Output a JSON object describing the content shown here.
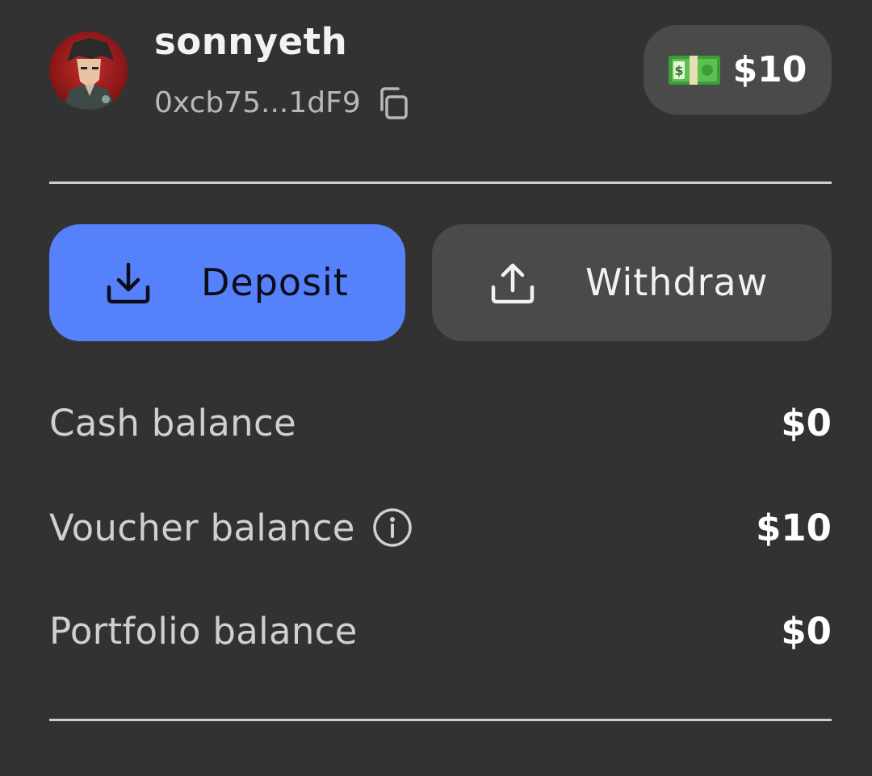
{
  "profile": {
    "username": "sonnyeth",
    "address": "0xcb75...1dF9",
    "avatar_icon": "anime-character-avatar",
    "copy_icon": "copy-icon"
  },
  "balance_pill": {
    "icon": "dollar-banknote-emoji",
    "amount": "$10"
  },
  "actions": {
    "deposit_label": "Deposit",
    "withdraw_label": "Withdraw"
  },
  "balances": [
    {
      "label": "Cash balance",
      "value": "$0"
    },
    {
      "label": "Voucher balance",
      "value": "$10"
    },
    {
      "label": "Portfolio balance",
      "value": "$0"
    }
  ],
  "colors": {
    "background": "#323232",
    "deposit_accent": "#5581fb",
    "secondary_button": "#4a4a4a"
  }
}
